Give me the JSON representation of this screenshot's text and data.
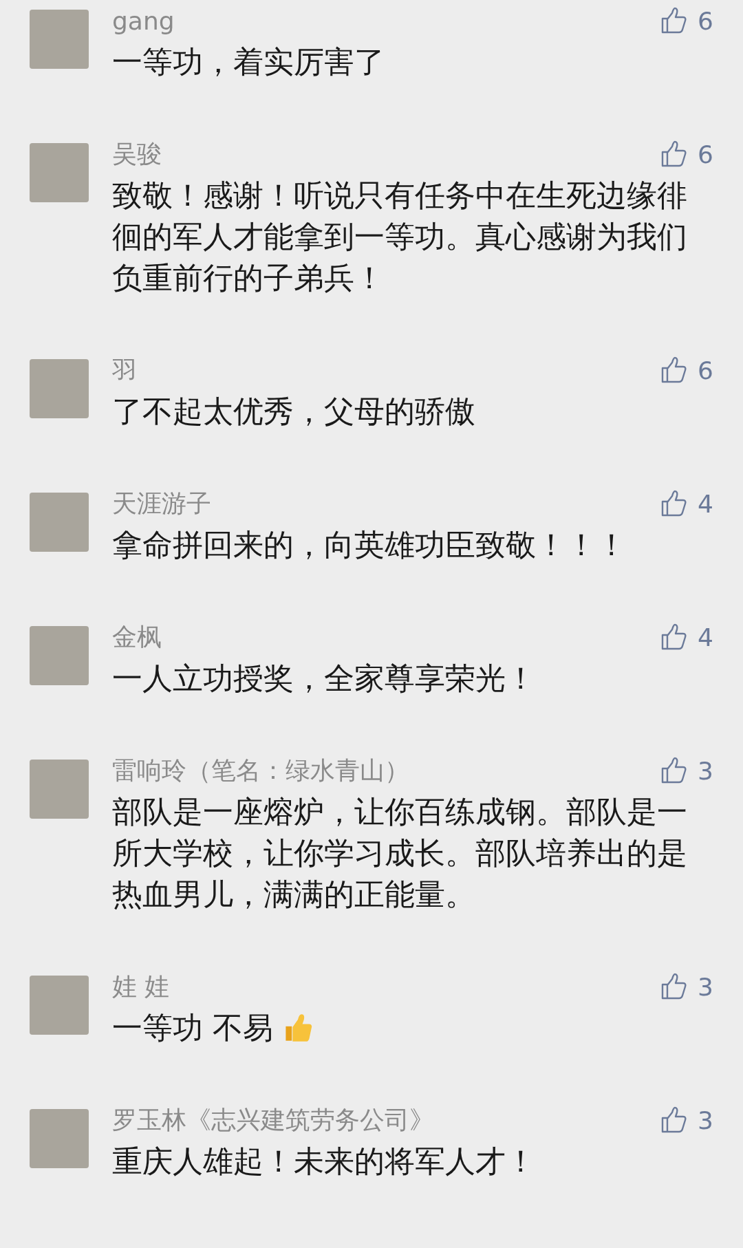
{
  "comments": [
    {
      "name": "gang",
      "text": "一等功，着实厉害了",
      "likes": "6"
    },
    {
      "name": "吴骏",
      "text": "致敬！感谢！听说只有任务中在生死边缘徘徊的军人才能拿到一等功。真心感谢为我们负重前行的子弟兵！",
      "likes": "6"
    },
    {
      "name": "羽",
      "text": "了不起太优秀，父母的骄傲",
      "likes": "6"
    },
    {
      "name": "天涯游子",
      "text": "拿命拼回来的，向英雄功臣致敬！！！",
      "likes": "4"
    },
    {
      "name": "金枫",
      "text": "一人立功授奖，全家尊享荣光！",
      "likes": "4"
    },
    {
      "name": "雷响玲（笔名：绿水青山）",
      "text": "部队是一座熔炉，让你百练成钢。部队是一所大学校，让你学习成长。部队培养出的是热血男儿，满满的正能量。",
      "likes": "3"
    },
    {
      "name": "娃 娃",
      "text": "一等功 不易",
      "thumb_emoji": true,
      "likes": "3"
    },
    {
      "name": "罗玉林《志兴建筑劳务公司》",
      "text": "重庆人雄起！未来的将军人才！",
      "likes": "3"
    }
  ]
}
